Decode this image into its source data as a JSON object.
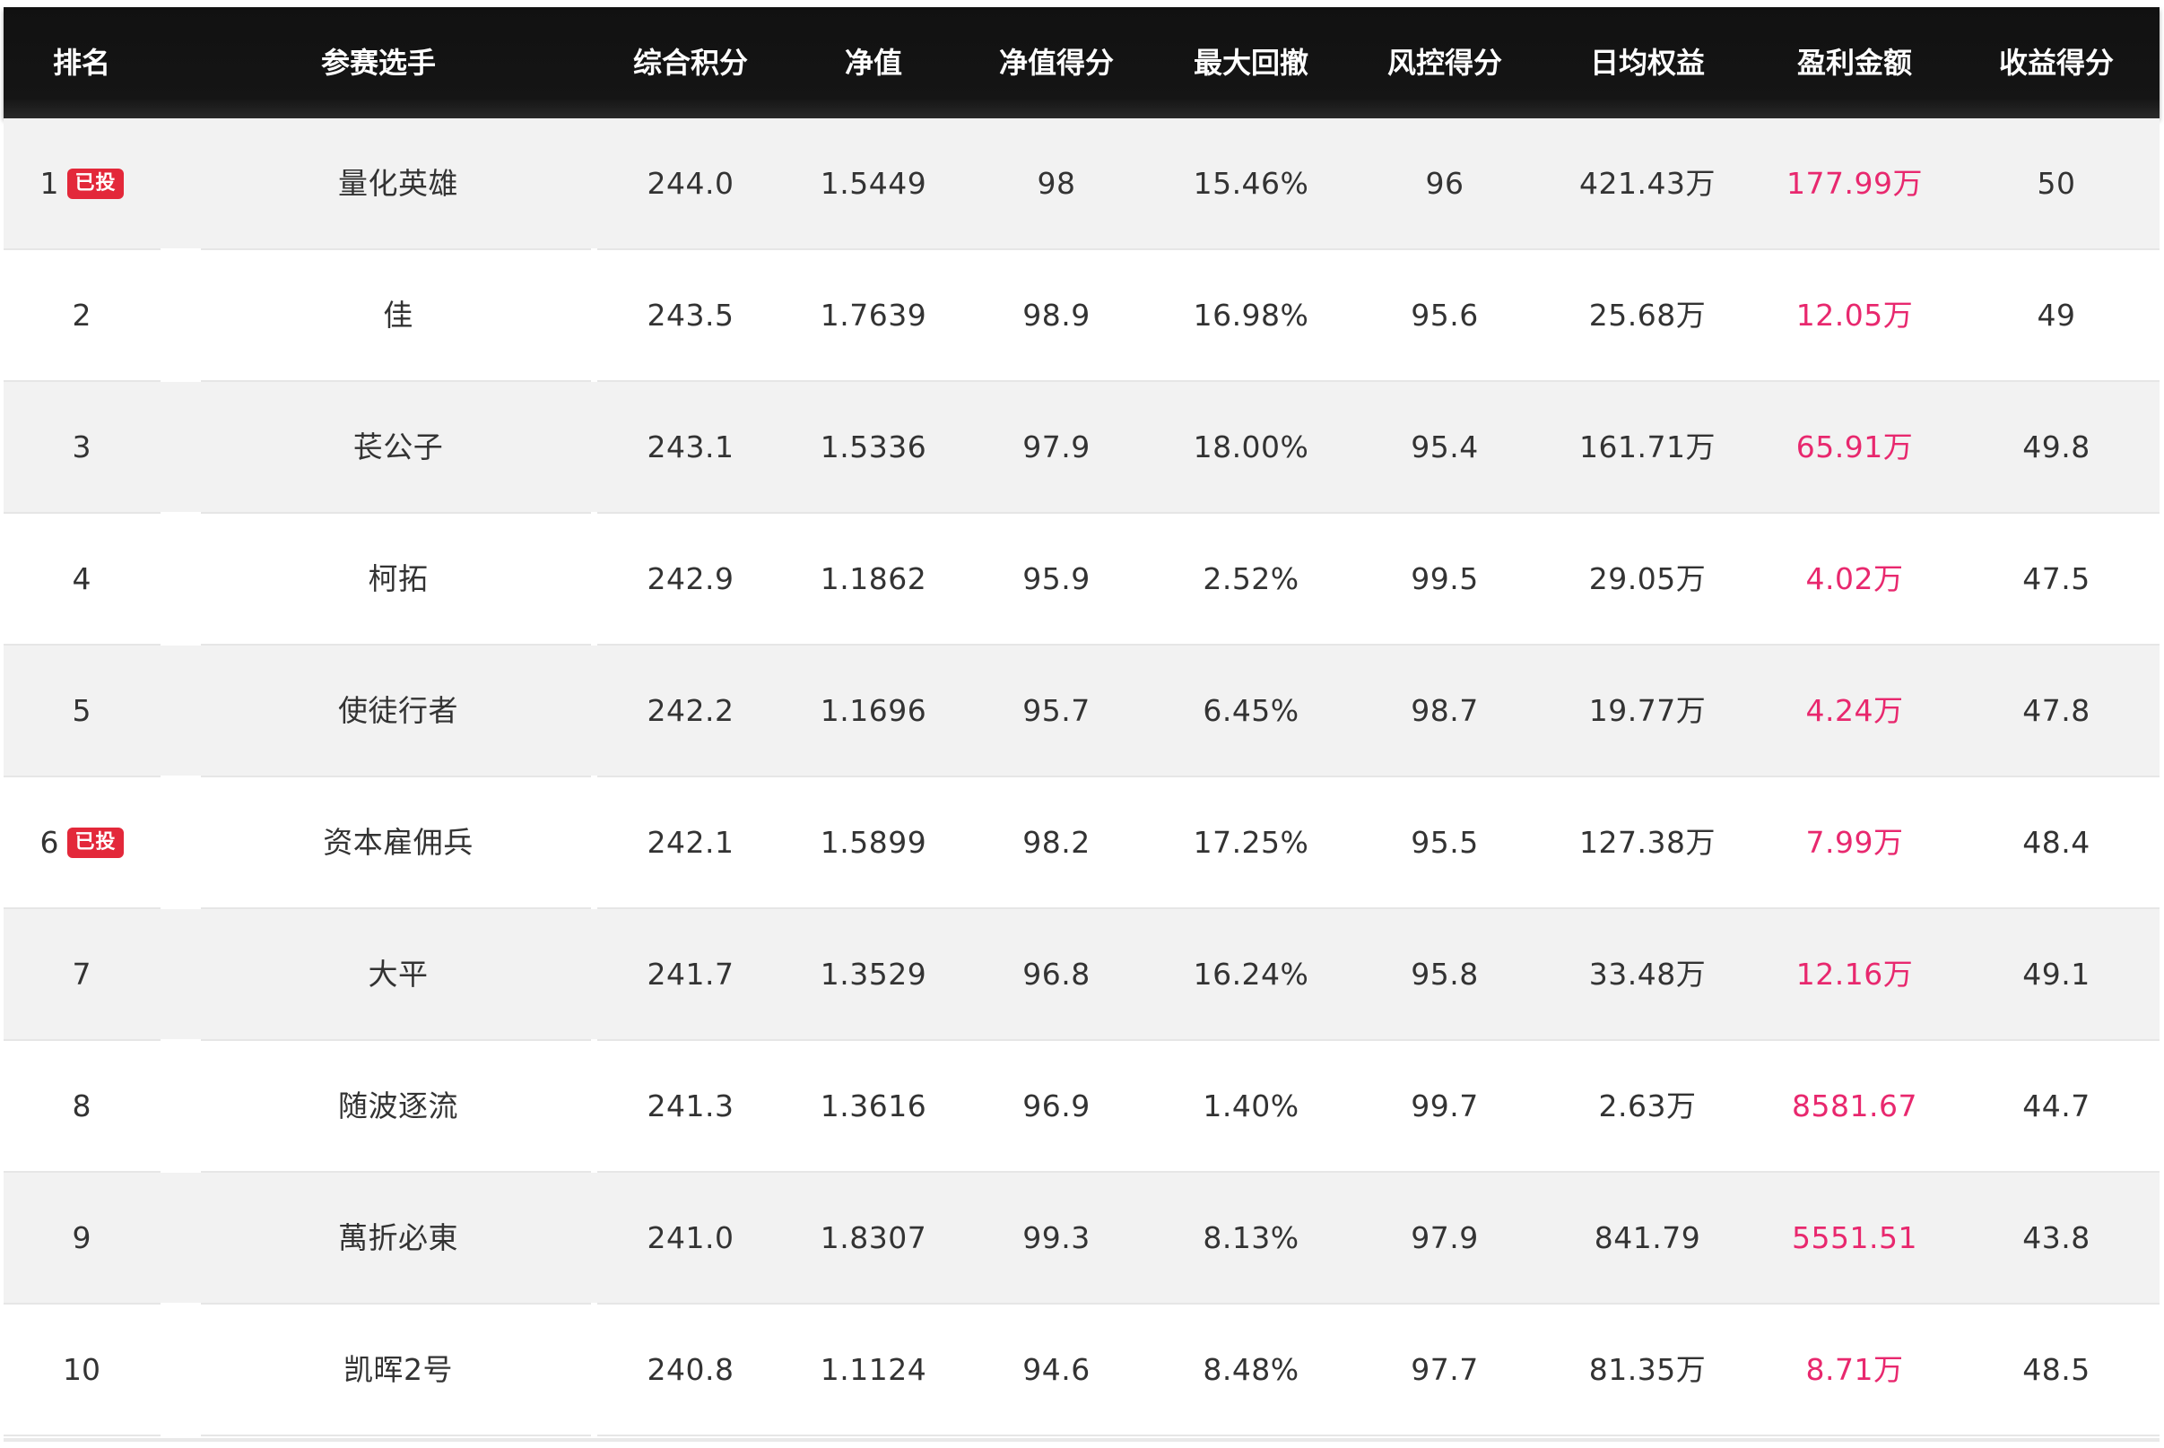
{
  "headers": [
    "排名",
    "参赛选手",
    "综合积分",
    "净值",
    "净值得分",
    "最大回撤",
    "风控得分",
    "日均权益",
    "盈利金额",
    "收益得分"
  ],
  "colors": {
    "header_bg": "#111111",
    "row_alt": "#f2f2f2",
    "profit": "#e8286e",
    "badge": "#e3283a"
  },
  "rows": [
    {
      "rank": "1",
      "badge": "已投",
      "player": "量化英雄",
      "score": "244.0",
      "nav": "1.5449",
      "nav_score": "98",
      "max_dd": "15.46%",
      "risk_score": "96",
      "avg_equity": "421.43万",
      "profit": "177.99万",
      "return_score": "50"
    },
    {
      "rank": "2",
      "badge": "",
      "player": "佳",
      "score": "243.5",
      "nav": "1.7639",
      "nav_score": "98.9",
      "max_dd": "16.98%",
      "risk_score": "95.6",
      "avg_equity": "25.68万",
      "profit": "12.05万",
      "return_score": "49"
    },
    {
      "rank": "3",
      "badge": "",
      "player": "苌公子",
      "score": "243.1",
      "nav": "1.5336",
      "nav_score": "97.9",
      "max_dd": "18.00%",
      "risk_score": "95.4",
      "avg_equity": "161.71万",
      "profit": "65.91万",
      "return_score": "49.8"
    },
    {
      "rank": "4",
      "badge": "",
      "player": "柯拓",
      "score": "242.9",
      "nav": "1.1862",
      "nav_score": "95.9",
      "max_dd": "2.52%",
      "risk_score": "99.5",
      "avg_equity": "29.05万",
      "profit": "4.02万",
      "return_score": "47.5"
    },
    {
      "rank": "5",
      "badge": "",
      "player": "使徒行者",
      "score": "242.2",
      "nav": "1.1696",
      "nav_score": "95.7",
      "max_dd": "6.45%",
      "risk_score": "98.7",
      "avg_equity": "19.77万",
      "profit": "4.24万",
      "return_score": "47.8"
    },
    {
      "rank": "6",
      "badge": "已投",
      "player": "资本雇佣兵",
      "score": "242.1",
      "nav": "1.5899",
      "nav_score": "98.2",
      "max_dd": "17.25%",
      "risk_score": "95.5",
      "avg_equity": "127.38万",
      "profit": "7.99万",
      "return_score": "48.4"
    },
    {
      "rank": "7",
      "badge": "",
      "player": "大平",
      "score": "241.7",
      "nav": "1.3529",
      "nav_score": "96.8",
      "max_dd": "16.24%",
      "risk_score": "95.8",
      "avg_equity": "33.48万",
      "profit": "12.16万",
      "return_score": "49.1"
    },
    {
      "rank": "8",
      "badge": "",
      "player": "随波逐流",
      "score": "241.3",
      "nav": "1.3616",
      "nav_score": "96.9",
      "max_dd": "1.40%",
      "risk_score": "99.7",
      "avg_equity": "2.63万",
      "profit": "8581.67",
      "return_score": "44.7"
    },
    {
      "rank": "9",
      "badge": "",
      "player": "萬折必東",
      "score": "241.0",
      "nav": "1.8307",
      "nav_score": "99.3",
      "max_dd": "8.13%",
      "risk_score": "97.9",
      "avg_equity": "841.79",
      "profit": "5551.51",
      "return_score": "43.8"
    },
    {
      "rank": "10",
      "badge": "",
      "player": "凯晖2号",
      "score": "240.8",
      "nav": "1.1124",
      "nav_score": "94.6",
      "max_dd": "8.48%",
      "risk_score": "97.7",
      "avg_equity": "81.35万",
      "profit": "8.71万",
      "return_score": "48.5"
    }
  ]
}
